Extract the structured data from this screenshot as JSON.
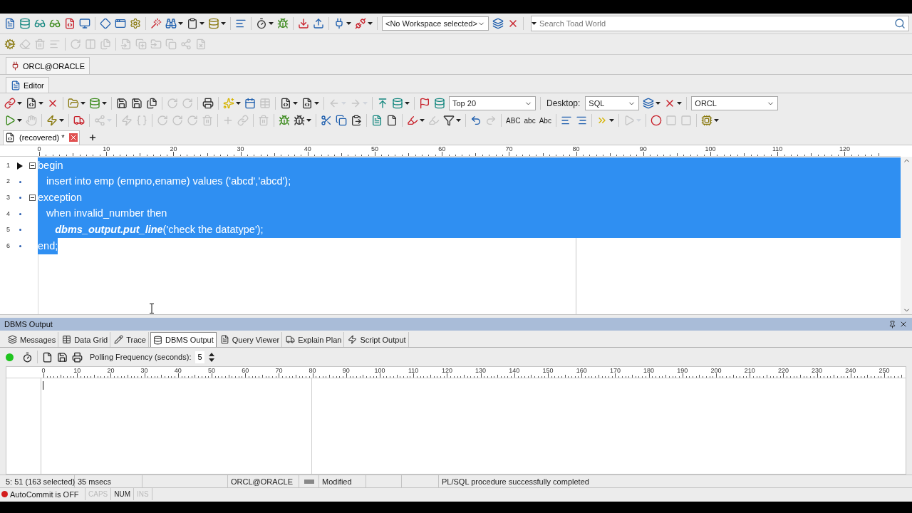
{
  "main_toolbar": [
    {
      "kind": "icon",
      "disabled": false,
      "dropdown": false
    },
    {
      "kind": "icon",
      "disabled": false,
      "dropdown": false
    },
    {
      "kind": "icon",
      "disabled": false,
      "dropdown": false
    },
    {
      "kind": "icon",
      "disabled": false,
      "dropdown": false
    },
    {
      "kind": "icon",
      "disabled": false,
      "dropdown": false
    },
    {
      "kind": "icon",
      "disabled": false,
      "dropdown": false
    },
    {
      "kind": "separator"
    },
    {
      "kind": "icon",
      "disabled": false,
      "dropdown": false
    },
    {
      "kind": "icon",
      "disabled": false,
      "dropdown": false
    },
    {
      "kind": "icon",
      "disabled": false,
      "dropdown": false
    },
    {
      "kind": "separator"
    },
    {
      "kind": "icon",
      "disabled": false,
      "dropdown": false
    },
    {
      "kind": "icon",
      "disabled": false,
      "dropdown": true
    },
    {
      "kind": "icon",
      "disabled": false,
      "dropdown": true
    },
    {
      "kind": "icon",
      "disabled": false,
      "dropdown": true
    },
    {
      "kind": "separator"
    },
    {
      "kind": "icon",
      "disabled": false,
      "dropdown": false
    },
    {
      "kind": "separator"
    },
    {
      "kind": "icon",
      "disabled": false,
      "dropdown": true
    },
    {
      "kind": "icon",
      "disabled": false,
      "dropdown": false
    },
    {
      "kind": "separator"
    },
    {
      "kind": "icon",
      "disabled": false,
      "dropdown": false
    },
    {
      "kind": "icon",
      "disabled": false,
      "dropdown": false
    },
    {
      "kind": "separator"
    },
    {
      "kind": "icon",
      "disabled": false,
      "dropdown": true
    },
    {
      "kind": "icon",
      "disabled": false,
      "dropdown": true
    },
    {
      "kind": "separator"
    },
    {
      "kind": "combo",
      "value": "<No Workspace selected>"
    },
    {
      "kind": "icon",
      "disabled": false,
      "dropdown": false
    },
    {
      "kind": "icon",
      "disabled": false,
      "dropdown": false
    },
    {
      "kind": "separator"
    },
    {
      "kind": "search",
      "placeholder": "Search Toad World"
    }
  ],
  "secondary_toolbar": [
    {
      "kind": "icon",
      "disabled": false,
      "dropdown": false
    },
    {
      "kind": "icon",
      "disabled": true,
      "dropdown": false
    },
    {
      "kind": "icon",
      "disabled": true,
      "dropdown": false
    },
    {
      "kind": "icon",
      "disabled": true,
      "dropdown": false
    },
    {
      "kind": "separator"
    },
    {
      "kind": "icon",
      "disabled": true,
      "dropdown": false
    },
    {
      "kind": "icon",
      "disabled": true,
      "dropdown": false
    },
    {
      "kind": "icon",
      "disabled": true,
      "dropdown": false
    },
    {
      "kind": "separator"
    },
    {
      "kind": "icon",
      "disabled": true,
      "dropdown": false
    },
    {
      "kind": "icon",
      "disabled": true,
      "dropdown": false
    },
    {
      "kind": "icon",
      "disabled": true,
      "dropdown": false
    },
    {
      "kind": "icon",
      "disabled": true,
      "dropdown": false
    },
    {
      "kind": "icon",
      "disabled": true,
      "dropdown": false
    },
    {
      "kind": "icon",
      "disabled": true,
      "dropdown": false
    }
  ],
  "connection_tab": {
    "label": "ORCL@ORACLE",
    "selected": true
  },
  "editor_tab": {
    "label": "Editor",
    "selected": true
  },
  "editor_toolbar": [
    {
      "kind": "icon",
      "disabled": false,
      "dropdown": true
    },
    {
      "kind": "icon",
      "disabled": false,
      "dropdown": true
    },
    {
      "kind": "icon",
      "disabled": false,
      "dropdown": false
    },
    {
      "kind": "separator"
    },
    {
      "kind": "icon",
      "disabled": false,
      "dropdown": true
    },
    {
      "kind": "icon",
      "disabled": false,
      "dropdown": true
    },
    {
      "kind": "separator"
    },
    {
      "kind": "icon",
      "disabled": false,
      "dropdown": false
    },
    {
      "kind": "icon",
      "disabled": false,
      "dropdown": false
    },
    {
      "kind": "icon",
      "disabled": false,
      "dropdown": false
    },
    {
      "kind": "separator"
    },
    {
      "kind": "icon",
      "disabled": true,
      "dropdown": false
    },
    {
      "kind": "icon",
      "disabled": true,
      "dropdown": false
    },
    {
      "kind": "separator"
    },
    {
      "kind": "icon",
      "disabled": false,
      "dropdown": false
    },
    {
      "kind": "separator"
    },
    {
      "kind": "icon",
      "disabled": false,
      "dropdown": true
    },
    {
      "kind": "icon",
      "disabled": false,
      "dropdown": false
    },
    {
      "kind": "icon",
      "disabled": true,
      "dropdown": false
    },
    {
      "kind": "separator"
    },
    {
      "kind": "icon",
      "disabled": false,
      "dropdown": true
    },
    {
      "kind": "icon",
      "disabled": false,
      "dropdown": true
    },
    {
      "kind": "separator"
    },
    {
      "kind": "icon",
      "disabled": true,
      "dropdown": true
    },
    {
      "kind": "icon",
      "disabled": true,
      "dropdown": true
    },
    {
      "kind": "separator"
    },
    {
      "kind": "icon",
      "disabled": false,
      "dropdown": false
    },
    {
      "kind": "icon",
      "disabled": false,
      "dropdown": true
    },
    {
      "kind": "separator"
    },
    {
      "kind": "icon",
      "disabled": false,
      "dropdown": false
    },
    {
      "kind": "icon",
      "disabled": false,
      "dropdown": false
    },
    {
      "kind": "combo",
      "value": "Top 20"
    },
    {
      "kind": "separator"
    },
    {
      "kind": "label",
      "text": "Desktop:"
    },
    {
      "kind": "combo",
      "value": "SQL"
    },
    {
      "kind": "icon",
      "disabled": false,
      "dropdown": true
    },
    {
      "kind": "icon",
      "disabled": false,
      "dropdown": true
    },
    {
      "kind": "separator"
    },
    {
      "kind": "combo",
      "value": "ORCL"
    }
  ],
  "editor_toolbar_2": [
    {
      "kind": "icon",
      "disabled": false,
      "dropdown": true
    },
    {
      "kind": "icon",
      "disabled": true,
      "dropdown": false
    },
    {
      "kind": "separator"
    },
    {
      "kind": "icon",
      "disabled": false,
      "dropdown": true
    },
    {
      "kind": "separator"
    },
    {
      "kind": "icon",
      "disabled": false,
      "dropdown": false
    },
    {
      "kind": "separator"
    },
    {
      "kind": "icon",
      "disabled": true,
      "dropdown": true
    },
    {
      "kind": "separator"
    },
    {
      "kind": "icon",
      "disabled": true,
      "dropdown": false
    },
    {
      "kind": "icon",
      "disabled": true,
      "dropdown": false
    },
    {
      "kind": "separator"
    },
    {
      "kind": "icon",
      "disabled": true,
      "dropdown": false
    },
    {
      "kind": "icon",
      "disabled": true,
      "dropdown": false
    },
    {
      "kind": "icon",
      "disabled": true,
      "dropdown": false
    },
    {
      "kind": "icon",
      "disabled": true,
      "dropdown": false
    },
    {
      "kind": "separator"
    },
    {
      "kind": "icon",
      "disabled": true,
      "dropdown": false
    },
    {
      "kind": "icon",
      "disabled": true,
      "dropdown": false
    },
    {
      "kind": "separator"
    },
    {
      "kind": "icon",
      "disabled": true,
      "dropdown": false
    },
    {
      "kind": "separator"
    },
    {
      "kind": "icon",
      "disabled": false,
      "dropdown": false
    },
    {
      "kind": "icon",
      "disabled": false,
      "dropdown": true
    },
    {
      "kind": "separator"
    },
    {
      "kind": "icon",
      "disabled": false,
      "dropdown": false
    },
    {
      "kind": "icon",
      "disabled": false,
      "dropdown": false
    },
    {
      "kind": "icon",
      "disabled": false,
      "dropdown": false
    },
    {
      "kind": "separator"
    },
    {
      "kind": "icon",
      "disabled": false,
      "dropdown": false
    },
    {
      "kind": "icon",
      "disabled": false,
      "dropdown": false
    },
    {
      "kind": "separator"
    },
    {
      "kind": "icon",
      "disabled": false,
      "dropdown": true
    },
    {
      "kind": "icon",
      "disabled": true,
      "dropdown": false
    },
    {
      "kind": "icon",
      "disabled": false,
      "dropdown": true
    },
    {
      "kind": "separator"
    },
    {
      "kind": "icon",
      "disabled": false,
      "dropdown": false
    },
    {
      "kind": "icon",
      "disabled": true,
      "dropdown": false
    },
    {
      "kind": "separator"
    },
    {
      "kind": "text",
      "text": "ABC"
    },
    {
      "kind": "text",
      "text": "abc"
    },
    {
      "kind": "text",
      "text": "Abc"
    },
    {
      "kind": "separator"
    },
    {
      "kind": "icon",
      "disabled": false,
      "dropdown": false
    },
    {
      "kind": "icon",
      "disabled": false,
      "dropdown": false
    },
    {
      "kind": "separator"
    },
    {
      "kind": "icon",
      "disabled": false,
      "dropdown": true
    },
    {
      "kind": "separator"
    },
    {
      "kind": "icon",
      "disabled": true,
      "dropdown": true
    },
    {
      "kind": "separator"
    },
    {
      "kind": "icon",
      "disabled": false,
      "dropdown": false
    },
    {
      "kind": "icon",
      "disabled": true,
      "dropdown": false
    },
    {
      "kind": "icon",
      "disabled": true,
      "dropdown": false
    },
    {
      "kind": "separator"
    },
    {
      "kind": "icon",
      "disabled": false,
      "dropdown": true
    }
  ],
  "document_tab": {
    "label": "(recovered) *",
    "selected": true
  },
  "editor_ruler": [
    "0",
    "10",
    "20",
    "30",
    "40",
    "50",
    "60",
    "70",
    "80",
    "90",
    "100",
    "110",
    "120"
  ],
  "code_lines": [
    {
      "number": "1",
      "text": "begin",
      "selected": true,
      "expanded": true,
      "current": true
    },
    {
      "number": "2",
      "text": "   insert into emp (empno,ename) values ('abcd','abcd');",
      "selected": true,
      "current": false
    },
    {
      "number": "3",
      "text": "exception",
      "selected": true,
      "expanded": true,
      "current": false
    },
    {
      "number": "4",
      "text": "   when invalid_number then",
      "selected": true,
      "current": false
    },
    {
      "number": "5",
      "text": "      *dbms_output.put_line*('check the datatype');",
      "selected": true,
      "current": false
    },
    {
      "number": "6",
      "text": "end;",
      "selected": true,
      "current": false
    }
  ],
  "output_panel": {
    "title": "DBMS Output",
    "tabs": [
      {
        "label": "Messages",
        "selected": false
      },
      {
        "label": "Data Grid",
        "selected": false
      },
      {
        "label": "Trace",
        "selected": false
      },
      {
        "label": "DBMS Output",
        "selected": true
      },
      {
        "label": "Query Viewer",
        "selected": false
      },
      {
        "label": "Explain Plan",
        "selected": false
      },
      {
        "label": "Script Output",
        "selected": false
      }
    ],
    "output_on": true,
    "polling_label": "Polling Frequency (seconds):",
    "polling_value": "5",
    "ruler": [
      "0",
      "10",
      "20",
      "30",
      "40",
      "50",
      "60",
      "70",
      "80",
      "90",
      "100",
      "110",
      "120",
      "130",
      "140",
      "150",
      "160",
      "170",
      "180",
      "190",
      "200",
      "210",
      "220",
      "230",
      "240",
      "250"
    ]
  },
  "status_bar": {
    "position": "5: 51 (163 selected)",
    "duration": "35 msecs",
    "connection": "ORCL@ORACLE",
    "modified": "Modified",
    "message": "PL/SQL procedure successfully completed"
  },
  "status_bar_2": {
    "autocommit": "AutoCommit is OFF",
    "autocommit_on": false,
    "keys": [
      {
        "label": "CAPS",
        "on": false
      },
      {
        "label": "NUM",
        "on": true
      },
      {
        "label": "INS",
        "on": false
      }
    ]
  }
}
